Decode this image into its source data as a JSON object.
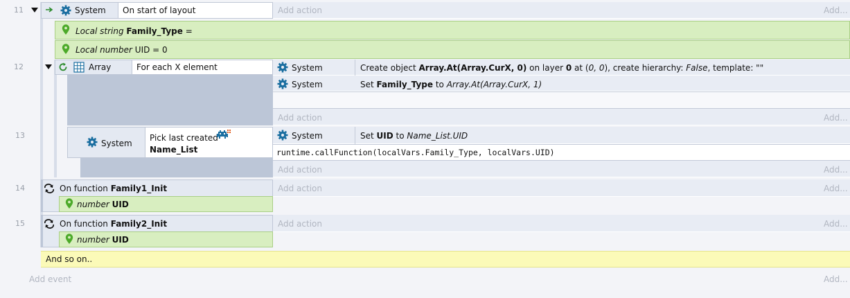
{
  "events": {
    "e11": {
      "number": "11",
      "condition_object": "System",
      "condition_text": "On start of layout",
      "add_action": "Add action",
      "add_more": "Add..."
    },
    "local_string": {
      "prefix": "Local string",
      "name": "Family_Type",
      "suffix": " ="
    },
    "local_number": {
      "prefix": "Local number",
      "name": "UID",
      "suffix": " = 0"
    },
    "e12": {
      "number": "12",
      "condition_object": "Array",
      "condition_text": "For each X element",
      "action1_object": "System",
      "action1_pre": "Create object ",
      "action1_b1": "Array.At(Array.CurX, 0)",
      "action1_mid": " on layer ",
      "action1_b2": "0",
      "action1_at": " at (",
      "action1_i1": "0, 0",
      "action1_hier": "), create hierarchy: ",
      "action1_i2": "False",
      "action1_tpl": ", template: \"\"",
      "action2_object": "System",
      "action2_pre": "Set ",
      "action2_b": "Family_Type",
      "action2_to": " to ",
      "action2_i": "Array.At(Array.CurX, 1)",
      "add_action": "Add action",
      "add_more": "Add..."
    },
    "e13": {
      "number": "13",
      "condition_object": "System",
      "condition_line1": "Pick last created",
      "condition_line2": "Name_List",
      "action1_object": "System",
      "action1_pre": "Set ",
      "action1_b": "UID",
      "action1_to": " to ",
      "action1_i": "Name_List.UID",
      "script_line": "runtime.callFunction(localVars.Family_Type, localVars.UID)",
      "add_action": "Add action",
      "add_more": "Add..."
    },
    "e14": {
      "number": "14",
      "prefix": "On function ",
      "name": "Family1_Init",
      "param_type": "number",
      "param_name": "UID",
      "add_action": "Add action",
      "add_more": "Add..."
    },
    "e15": {
      "number": "15",
      "prefix": "On function ",
      "name": "Family2_Init",
      "param_type": "number",
      "param_name": "UID",
      "add_action": "Add action",
      "add_more": "Add..."
    },
    "comment": "And so on..",
    "add_event": "Add event",
    "add_more": "Add..."
  },
  "colors": {
    "condition_bg": "#e4e9f2",
    "local_var_bg": "#d8eec0",
    "comment_bg": "#fbfab8",
    "icon_blue": "#1a6ea0",
    "icon_green": "#4caa2a"
  },
  "icons": [
    "arrow-right-icon",
    "gear-icon",
    "location-pin-icon",
    "loop-icon",
    "grid-icon",
    "invader-icon",
    "function-icon"
  ]
}
